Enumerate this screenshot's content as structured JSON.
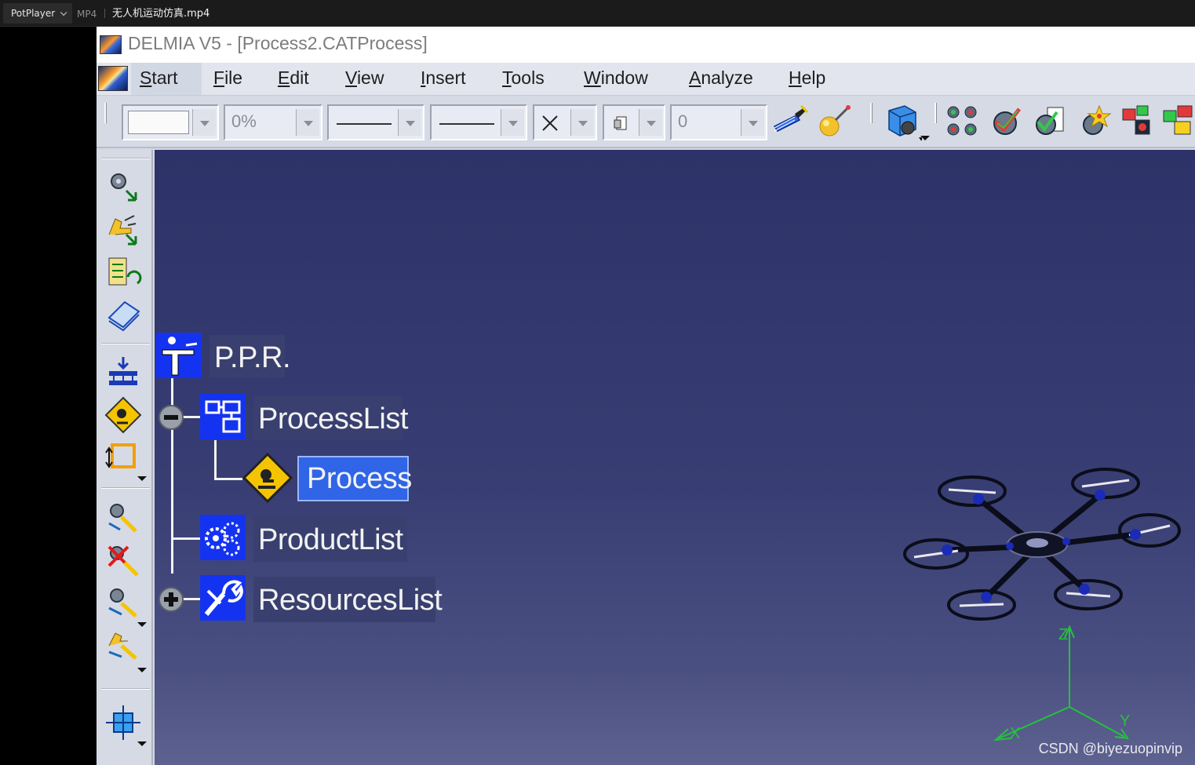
{
  "player": {
    "app_label": "PotPlayer",
    "format": "MP4",
    "filename": "无人机运动仿真.mp4"
  },
  "window": {
    "title": "DELMIA V5 - [Process2.CATProcess]"
  },
  "menu": {
    "items": [
      {
        "u": "S",
        "rest": "tart"
      },
      {
        "u": "F",
        "rest": "ile"
      },
      {
        "u": "E",
        "rest": "dit"
      },
      {
        "u": "V",
        "rest": "iew"
      },
      {
        "u": "I",
        "rest": "nsert"
      },
      {
        "u": "T",
        "rest": "ools"
      },
      {
        "u": "W",
        "rest": "indow"
      },
      {
        "u": "A",
        "rest": "nalyze"
      },
      {
        "u": "H",
        "rest": "elp"
      }
    ]
  },
  "toolbar": {
    "transparency_value": "0%",
    "thickness_value": "0"
  },
  "tree": {
    "root": "P.P.R.",
    "process_list": "ProcessList",
    "process": "Process",
    "product_list": "ProductList",
    "resources_list": "ResourcesList"
  },
  "axes": {
    "z": "Z",
    "x": "X",
    "y": "Y"
  },
  "watermark": "CSDN @biyezuopinvip",
  "colors": {
    "viewport_top": "#2d3368",
    "viewport_bottom": "#5e6290",
    "tree_icon_bg": "#1433f1",
    "selection": "#2f65e6",
    "axis_green": "#22c43a"
  }
}
